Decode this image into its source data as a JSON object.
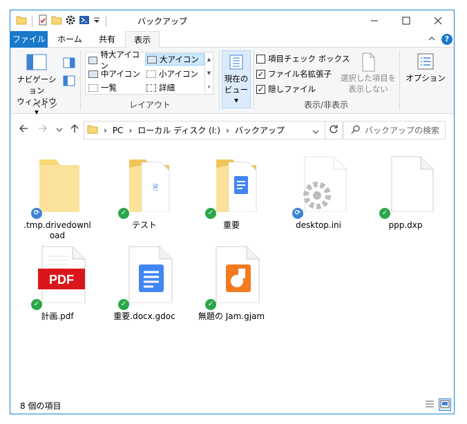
{
  "window": {
    "title": "バックアップ"
  },
  "tabs": [
    {
      "label": "ファイル"
    },
    {
      "label": "ホーム"
    },
    {
      "label": "共有"
    },
    {
      "label": "表示"
    }
  ],
  "ribbon": {
    "pane": {
      "nav_pane_label_1": "ナビゲーション",
      "nav_pane_label_2": "ウィンドウ",
      "group_label": "ペイン"
    },
    "layout": {
      "options": [
        {
          "label": "特大アイコン"
        },
        {
          "label": "大アイコン"
        },
        {
          "label": "中アイコン"
        },
        {
          "label": "小アイコン"
        },
        {
          "label": "一覧"
        },
        {
          "label": "詳細"
        }
      ],
      "selected": "大アイコン",
      "group_label": "レイアウト"
    },
    "current_view": {
      "label_1": "現在の",
      "label_2": "ビュー"
    },
    "show_hide": {
      "checkboxes": [
        {
          "label": "項目チェック ボックス",
          "checked": false
        },
        {
          "label": "ファイル名拡張子",
          "checked": true
        },
        {
          "label": "隠しファイル",
          "checked": true
        }
      ],
      "hide_selected_1": "選択した項目を",
      "hide_selected_2": "表示しない",
      "group_label": "表示/非表示"
    },
    "options_label": "オプション"
  },
  "address": {
    "segments": [
      "PC",
      "ローカル ディスク (I:)",
      "バックアップ"
    ],
    "search_placeholder": "バックアップの検索"
  },
  "files": [
    {
      "name": ".tmp.drivedownload",
      "name_line1": ".tmp.drivedownl",
      "name_line2": "oad",
      "type": "folder-empty",
      "status": "sync"
    },
    {
      "name": "テスト",
      "type": "folder-with-file",
      "status": "ok"
    },
    {
      "name": "重要",
      "type": "folder-with-doc",
      "status": "ok"
    },
    {
      "name": "desktop.ini",
      "type": "settings-file",
      "status": "sync"
    },
    {
      "name": "ppp.dxp",
      "type": "blank-file",
      "status": "ok"
    },
    {
      "name": "計画.pdf",
      "type": "pdf-file",
      "status": "ok",
      "badge_text": "PDF"
    },
    {
      "name": "重要.docx.gdoc",
      "type": "gdoc-file",
      "status": "ok"
    },
    {
      "name": "無題の Jam.gjam",
      "type": "gjam-file",
      "status": "ok"
    }
  ],
  "status": {
    "item_count": "8 個の項目"
  },
  "colors": {
    "accent": "#1979ca",
    "folder": "#f8d775",
    "pdf_red": "#d9161c",
    "gdoc_blue": "#4285f4",
    "jam_orange": "#f37a1e",
    "badge_ok": "#2aa74a",
    "badge_sync": "#3c82d4"
  }
}
